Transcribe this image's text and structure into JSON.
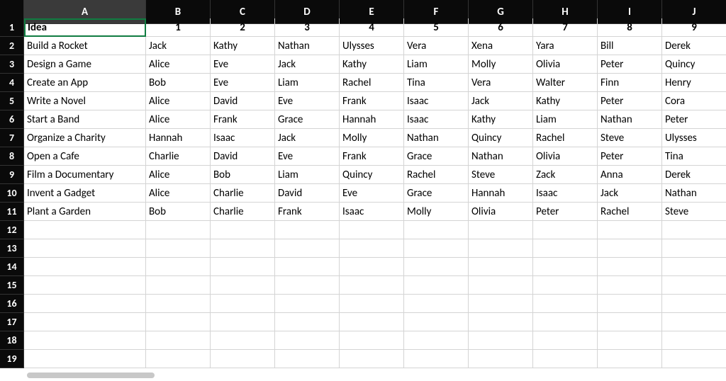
{
  "columns": [
    "A",
    "B",
    "C",
    "D",
    "E",
    "F",
    "G",
    "H",
    "I",
    "J"
  ],
  "rowNumbers": [
    1,
    2,
    3,
    4,
    5,
    6,
    7,
    8,
    9,
    10,
    11,
    12,
    13,
    14,
    15,
    16,
    17,
    18,
    19
  ],
  "selectedColumn": "A",
  "selectedCell": {
    "row": 1,
    "col": "A"
  },
  "headerRow": [
    "Idea",
    "1",
    "2",
    "3",
    "4",
    "5",
    "6",
    "7",
    "8",
    "9"
  ],
  "dataRows": [
    [
      "Build a Rocket",
      "Jack",
      "Kathy",
      "Nathan",
      "Ulysses",
      "Vera",
      "Xena",
      "Yara",
      "Bill",
      "Derek"
    ],
    [
      "Design a Game",
      "Alice",
      "Eve",
      "Jack",
      "Kathy",
      "Liam",
      "Molly",
      "Olivia",
      "Peter",
      "Quincy"
    ],
    [
      "Create an App",
      "Bob",
      "Eve",
      "Liam",
      "Rachel",
      "Tina",
      "Vera",
      "Walter",
      "Finn",
      "Henry"
    ],
    [
      "Write a Novel",
      "Alice",
      "David",
      "Eve",
      "Frank",
      "Isaac",
      "Jack",
      "Kathy",
      "Peter",
      "Cora"
    ],
    [
      "Start a Band",
      "Alice",
      "Frank",
      "Grace",
      "Hannah",
      "Isaac",
      "Kathy",
      "Liam",
      "Nathan",
      "Peter"
    ],
    [
      "Organize a Charity",
      "Hannah",
      "Isaac",
      "Jack",
      "Molly",
      "Nathan",
      "Quincy",
      "Rachel",
      "Steve",
      "Ulysses"
    ],
    [
      "Open a Cafe",
      "Charlie",
      "David",
      "Eve",
      "Frank",
      "Grace",
      "Nathan",
      "Olivia",
      "Peter",
      "Tina"
    ],
    [
      "Film a Documentary",
      "Alice",
      "Bob",
      "Liam",
      "Quincy",
      "Rachel",
      "Steve",
      "Zack",
      "Anna",
      "Derek"
    ],
    [
      "Invent a Gadget",
      "Alice",
      "Charlie",
      "David",
      "Eve",
      "Grace",
      "Hannah",
      "Isaac",
      "Jack",
      "Nathan"
    ],
    [
      "Plant a Garden",
      "Bob",
      "Charlie",
      "Frank",
      "Isaac",
      "Molly",
      "Olivia",
      "Peter",
      "Rachel",
      "Steve"
    ]
  ],
  "emptyRowsStart": 12,
  "emptyRowsEnd": 19
}
